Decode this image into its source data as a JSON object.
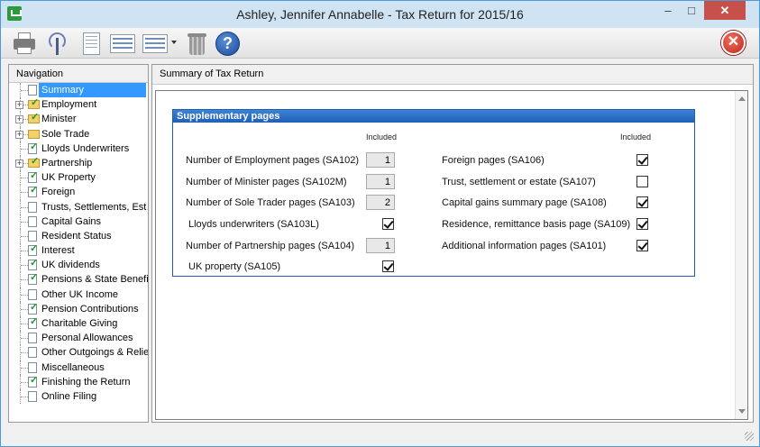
{
  "window": {
    "title": "Ashley, Jennifer Annabelle - Tax Return for 2015/16",
    "minimize": "–",
    "maximize": "□",
    "close": "✕"
  },
  "toolbar": {
    "exit_glyph": "✕",
    "help_glyph": "?"
  },
  "navigation": {
    "header": "Navigation",
    "items": [
      {
        "label": "Summary",
        "selected": true,
        "icon": "doc",
        "expander": false
      },
      {
        "label": "Employment",
        "icon": "folder-check",
        "expander": true
      },
      {
        "label": "Minister",
        "icon": "folder-check",
        "expander": true
      },
      {
        "label": "Sole Trade",
        "icon": "folder",
        "expander": true
      },
      {
        "label": "Lloyds Underwriters",
        "icon": "doc-check",
        "expander": false
      },
      {
        "label": "Partnership",
        "icon": "folder-check",
        "expander": true
      },
      {
        "label": "UK Property",
        "icon": "doc-check",
        "expander": false
      },
      {
        "label": "Foreign",
        "icon": "doc-check",
        "expander": false
      },
      {
        "label": "Trusts, Settlements, Est…",
        "icon": "doc",
        "expander": false
      },
      {
        "label": "Capital Gains",
        "icon": "doc",
        "expander": false
      },
      {
        "label": "Resident Status",
        "icon": "doc",
        "expander": false
      },
      {
        "label": "Interest",
        "icon": "doc-check",
        "expander": false
      },
      {
        "label": "UK dividends",
        "icon": "doc-check",
        "expander": false
      },
      {
        "label": "Pensions & State Benefits",
        "icon": "doc-check",
        "expander": false
      },
      {
        "label": "Other UK Income",
        "icon": "doc",
        "expander": false
      },
      {
        "label": "Pension Contributions",
        "icon": "doc-check",
        "expander": false
      },
      {
        "label": "Charitable Giving",
        "icon": "doc-check",
        "expander": false
      },
      {
        "label": "Personal Allowances",
        "icon": "doc",
        "expander": false
      },
      {
        "label": "Other Outgoings & Relie…",
        "icon": "doc",
        "expander": false
      },
      {
        "label": "Miscellaneous",
        "icon": "doc",
        "expander": false
      },
      {
        "label": "Finishing the Return",
        "icon": "doc-check",
        "expander": false
      },
      {
        "label": "Online Filing",
        "icon": "doc",
        "expander": false
      }
    ]
  },
  "content": {
    "header": "Summary of Tax Return",
    "panel": {
      "title": "Supplementary pages",
      "included_label_left": "Included",
      "included_label_right": "Included",
      "left": [
        {
          "label": "Number of Employment pages (SA102)",
          "type": "number",
          "value": "1"
        },
        {
          "label": "Number of Minister pages (SA102M)",
          "type": "number",
          "value": "1"
        },
        {
          "label": "Number of Sole Trader pages (SA103)",
          "type": "number",
          "value": "2"
        },
        {
          "label": "Lloyds underwriters (SA103L)",
          "type": "check",
          "checked": true
        },
        {
          "label": "Number of Partnership pages (SA104)",
          "type": "number",
          "value": "1"
        },
        {
          "label": "UK property (SA105)",
          "type": "check",
          "checked": true
        }
      ],
      "right": [
        {
          "label": "Foreign pages (SA106)",
          "checked": true
        },
        {
          "label": "Trust, settlement or estate (SA107)",
          "checked": false
        },
        {
          "label": "Capital gains summary page (SA108)",
          "checked": true
        },
        {
          "label": "Residence, remittance basis page (SA109)",
          "checked": true
        },
        {
          "label": "Additional information pages (SA101)",
          "checked": true
        }
      ]
    }
  }
}
